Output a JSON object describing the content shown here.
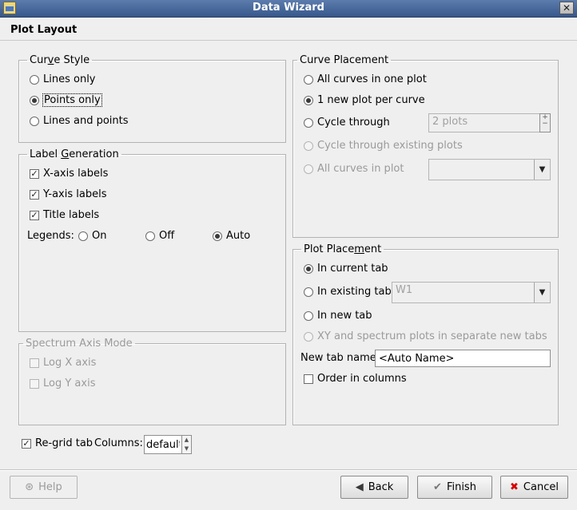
{
  "window": {
    "title": "Data Wizard",
    "close_glyph": "✕"
  },
  "page_title": "Plot Layout",
  "curve_style": {
    "legend": "Curve Style",
    "options": [
      "Lines only",
      "Points only",
      "Lines and points"
    ],
    "selected": "Points only"
  },
  "label_generation": {
    "legend": "Label Generation",
    "x_axis_labels": "X-axis labels",
    "y_axis_labels": "Y-axis labels",
    "title_labels": "Title labels",
    "legends_label": "Legends:",
    "legend_options": [
      "On",
      "Off",
      "Auto"
    ],
    "legend_selected": "Auto"
  },
  "spectrum_axis_mode": {
    "legend": "Spectrum Axis Mode",
    "log_x": "Log X axis",
    "log_y": "Log Y axis"
  },
  "curve_placement": {
    "legend": "Curve Placement",
    "all_in_one": "All curves in one plot",
    "one_per_curve": "1 new plot per curve",
    "cycle_through": "Cycle through",
    "cycle_value": "2 plots",
    "cycle_existing": "Cycle through existing plots",
    "all_in_plot": "All curves in plot",
    "all_in_plot_value": "",
    "selected": "1 new plot per curve"
  },
  "plot_placement": {
    "legend": "Plot Placement",
    "in_current_tab": "In current tab",
    "in_existing_tab": "In existing tab",
    "existing_tab_value": "W1",
    "in_new_tab": "In new tab",
    "separate_tabs": "XY and spectrum plots in separate new tabs",
    "new_tab_name_label": "New tab name:",
    "new_tab_name_value": "<Auto Name>",
    "order_in_columns": "Order in columns",
    "selected": "In current tab"
  },
  "regrid": {
    "label": "Re-grid tab",
    "checked": true,
    "columns_label": "Columns:",
    "columns_value": "default"
  },
  "buttons": {
    "help": "Help",
    "back": "Back",
    "finish": "Finish",
    "cancel": "Cancel"
  }
}
